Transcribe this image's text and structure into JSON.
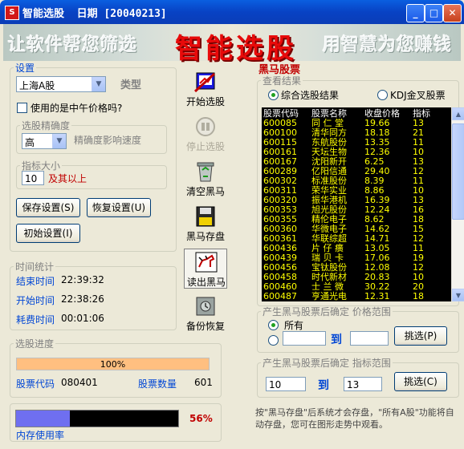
{
  "window": {
    "title": "智能选股  日期 [20040213]",
    "app_icon_text": "S"
  },
  "banner": {
    "left_slogan": "让软件帮您筛选",
    "center_title": "智能选股",
    "right_slogan": "用智慧为您赚钱"
  },
  "settings": {
    "legend": "设置",
    "market_value": "上海A股",
    "type_label": "类型",
    "midday_price_label": "使用的是中午价格吗?",
    "midday_price_checked": false,
    "precision_legend": "选股精确度",
    "precision_value": "高",
    "precision_hint": "精确度影响速度",
    "indicator_legend": "指标大小",
    "indicator_value": "10",
    "indicator_suffix": "及其以上",
    "save_btn": "保存设置(S)",
    "restore_btn": "恢复设置(U)",
    "init_btn": "初始设置(I)"
  },
  "time_stats": {
    "legend": "时间统计",
    "end_label": "结束时间",
    "end_value": "22:39:32",
    "start_label": "开始时间",
    "start_value": "22:38:26",
    "elapsed_label": "耗费时间",
    "elapsed_value": "00:01:06"
  },
  "progress": {
    "legend": "选股进度",
    "percent_text": "100%",
    "percent": 100,
    "code_label": "股票代码",
    "code_value": "080401",
    "count_label": "股票数量",
    "count_value": "601"
  },
  "memory": {
    "percent_text": "56%",
    "percent": 56,
    "label": "内存使用率"
  },
  "tools": {
    "start": "开始选股",
    "stop": "停止选股",
    "clear": "清空黑马",
    "store": "黑马存盘",
    "read": "读出黑马",
    "backup": "备份恢复"
  },
  "results": {
    "panel_title": "黑马股票",
    "view_legend": "查看结果",
    "radio_overall": "综合选股结果",
    "radio_kdj": "KDJ金叉股票",
    "headers": [
      "股票代码",
      "股票名称",
      "收盘价格",
      "指标"
    ],
    "rows": [
      [
        "600085",
        "同 仁 堂",
        "19.66",
        "13"
      ],
      [
        "600100",
        "清华同方",
        "18.18",
        "21"
      ],
      [
        "600115",
        "东航股份",
        "13.35",
        "11"
      ],
      [
        "600161",
        "天坛生物",
        "12.36",
        "10"
      ],
      [
        "600167",
        "沈阳新开",
        "6.25",
        "13"
      ],
      [
        "600289",
        "亿阳信通",
        "29.40",
        "12"
      ],
      [
        "600302",
        "标准股份",
        "8.39",
        "11"
      ],
      [
        "600311",
        "荣华实业",
        "8.86",
        "10"
      ],
      [
        "600320",
        "振华港机",
        "16.39",
        "13"
      ],
      [
        "600353",
        "旭光股份",
        "12.24",
        "16"
      ],
      [
        "600355",
        "精伦电子",
        "8.62",
        "18"
      ],
      [
        "600360",
        "华微电子",
        "14.62",
        "15"
      ],
      [
        "600361",
        "华联综超",
        "14.71",
        "12"
      ],
      [
        "600436",
        "片 仔 癀",
        "13.05",
        "11"
      ],
      [
        "600439",
        "瑞 贝 卡",
        "17.06",
        "19"
      ],
      [
        "600456",
        "宝钛股份",
        "12.08",
        "12"
      ],
      [
        "600458",
        "时代新材",
        "20.83",
        "10"
      ],
      [
        "600460",
        "士 兰 微",
        "30.22",
        "20"
      ],
      [
        "600487",
        "亨通光电",
        "12.31",
        "18"
      ]
    ]
  },
  "price_range": {
    "legend": "产生黑马股票后确定 价格范围",
    "radio_all": "所有",
    "to_label": "到",
    "from_value": "",
    "to_value": "",
    "filter_btn": "挑选(P)"
  },
  "indicator_range": {
    "legend": "产生黑马股票后确定 指标范围",
    "from_value": "10",
    "to_label": "到",
    "to_value": "13",
    "filter_btn": "挑选(C)"
  },
  "status_text": "按\"黑马存盘\"后系统才会存盘，\"所有A股\"功能将自动存盘，您可在图形走势中观看。"
}
